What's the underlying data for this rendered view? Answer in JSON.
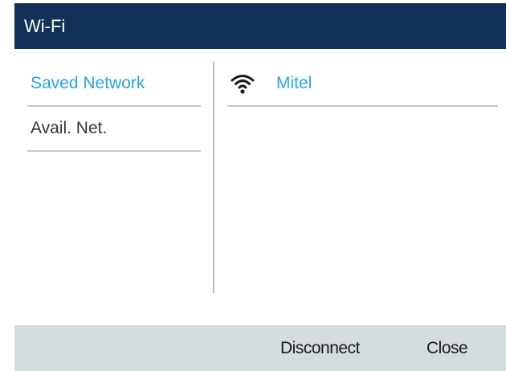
{
  "header": {
    "title": "Wi-Fi"
  },
  "left_menu": {
    "items": [
      {
        "label": "Saved Network",
        "selected": true
      },
      {
        "label": "Avail. Net.",
        "selected": false
      }
    ]
  },
  "networks": [
    {
      "name": "Mitel",
      "icon": "wifi-signal-icon"
    }
  ],
  "softkeys": {
    "disconnect_label": "Disconnect",
    "close_label": "Close"
  },
  "colors": {
    "header_bg": "#123158",
    "accent": "#2aa4e0",
    "softkey_bar_bg": "#d5dcdf"
  }
}
